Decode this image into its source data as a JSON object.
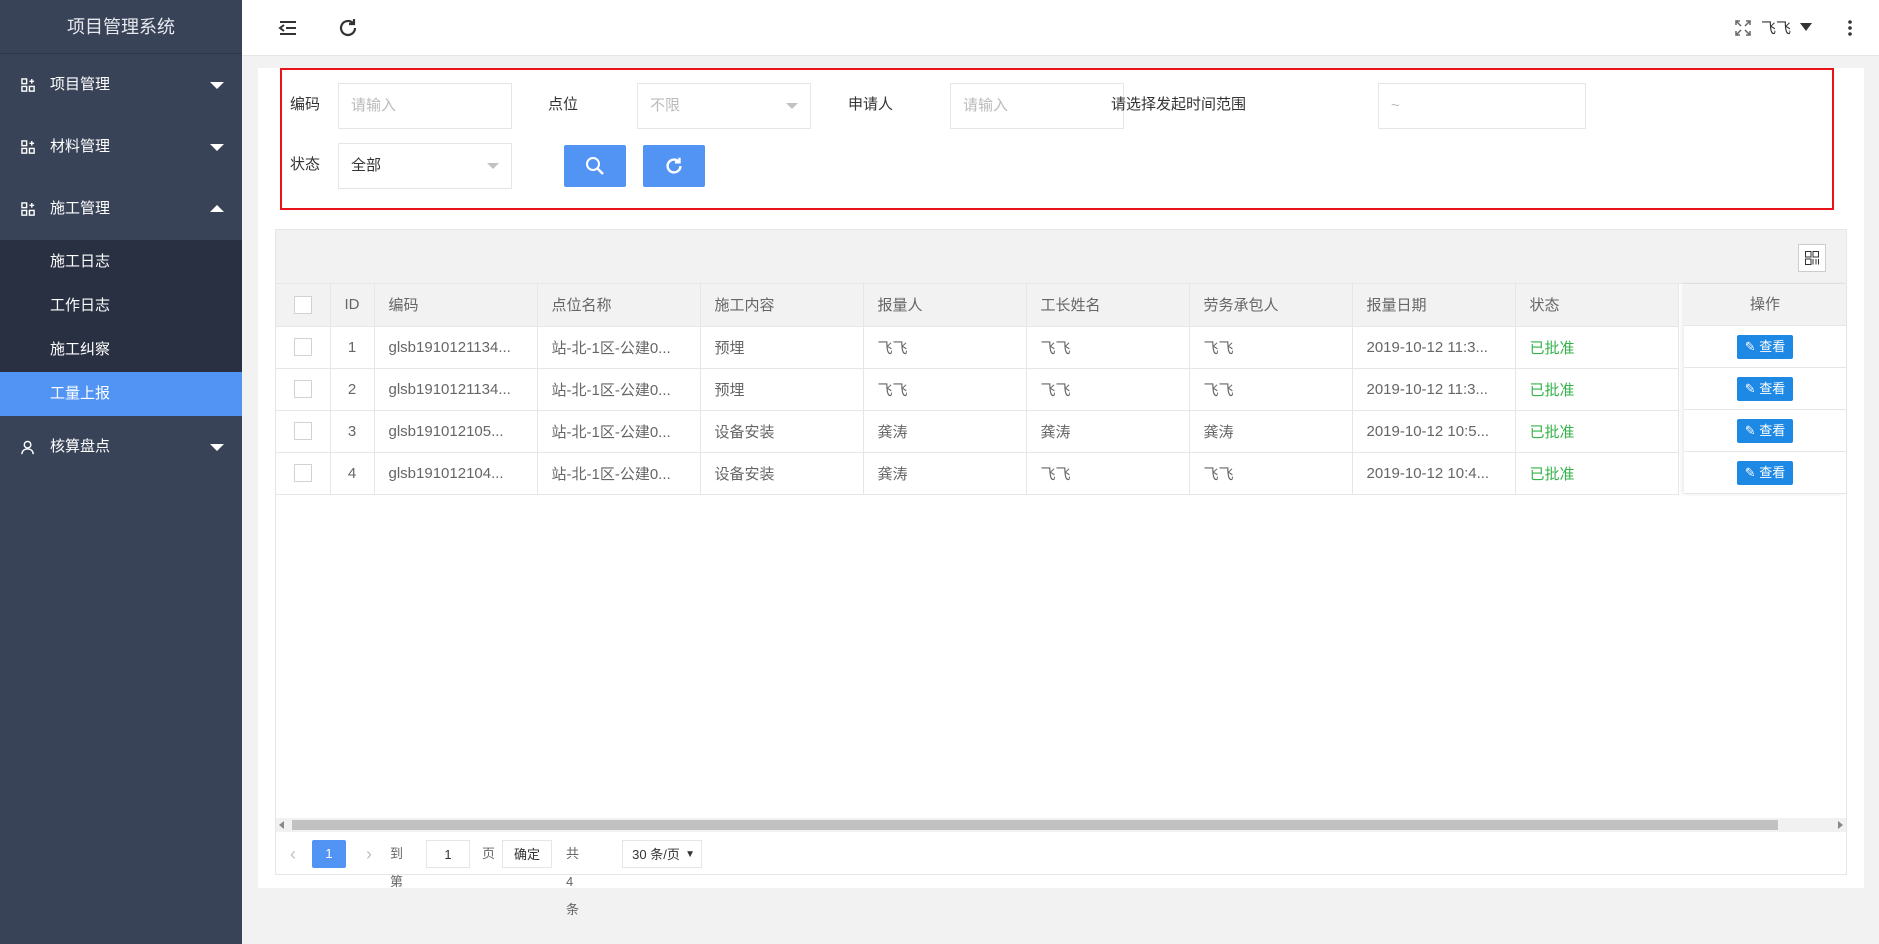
{
  "app": {
    "title": "项目管理系统"
  },
  "sidebar": {
    "items": [
      {
        "label": "项目管理",
        "expanded": false
      },
      {
        "label": "材料管理",
        "expanded": false
      },
      {
        "label": "施工管理",
        "expanded": true
      },
      {
        "label": "核算盘点",
        "expanded": false
      }
    ],
    "submenu": [
      {
        "label": "施工日志"
      },
      {
        "label": "工作日志"
      },
      {
        "label": "施工纠察"
      },
      {
        "label": "工量上报",
        "active": true
      }
    ]
  },
  "header": {
    "user": "飞飞"
  },
  "filters": {
    "code_label": "编码",
    "code_placeholder": "请输入",
    "point_label": "点位",
    "point_value": "不限",
    "applicant_label": "申请人",
    "applicant_placeholder": "请输入",
    "time_label": "请选择发起时间范围",
    "time_placeholder": "~",
    "status_label": "状态",
    "status_value": "全部"
  },
  "table": {
    "columns": [
      "ID",
      "编码",
      "点位名称",
      "施工内容",
      "报量人",
      "工长姓名",
      "劳务承包人",
      "报量日期",
      "状态"
    ],
    "op_header": "操作",
    "view_label": "查看",
    "rows": [
      {
        "id": "1",
        "code": "glsb1910121134...",
        "point": "站-北-1区-公建0...",
        "content": "预埋",
        "reporter": "飞飞",
        "foreman": "飞飞",
        "contractor": "飞飞",
        "date": "2019-10-12 11:3...",
        "status": "已批准"
      },
      {
        "id": "2",
        "code": "glsb1910121134...",
        "point": "站-北-1区-公建0...",
        "content": "预埋",
        "reporter": "飞飞",
        "foreman": "飞飞",
        "contractor": "飞飞",
        "date": "2019-10-12 11:3...",
        "status": "已批准"
      },
      {
        "id": "3",
        "code": "glsb191012105...",
        "point": "站-北-1区-公建0...",
        "content": "设备安装",
        "reporter": "龚涛",
        "foreman": "龚涛",
        "contractor": "龚涛",
        "date": "2019-10-12 10:5...",
        "status": "已批准"
      },
      {
        "id": "4",
        "code": "glsb191012104...",
        "point": "站-北-1区-公建0...",
        "content": "设备安装",
        "reporter": "龚涛",
        "foreman": "飞飞",
        "contractor": "飞飞",
        "date": "2019-10-12 10:4...",
        "status": "已批准"
      }
    ]
  },
  "pager": {
    "current": "1",
    "goto_label": "到第",
    "goto_value": "1",
    "page_label": "页",
    "confirm_label": "确定",
    "total": "共 4 条",
    "page_size": "30 条/页"
  },
  "colors": {
    "accent": "#5294f4",
    "sidebar": "#394358",
    "status_ok": "#35b34a",
    "highlight": "#e8141a"
  }
}
